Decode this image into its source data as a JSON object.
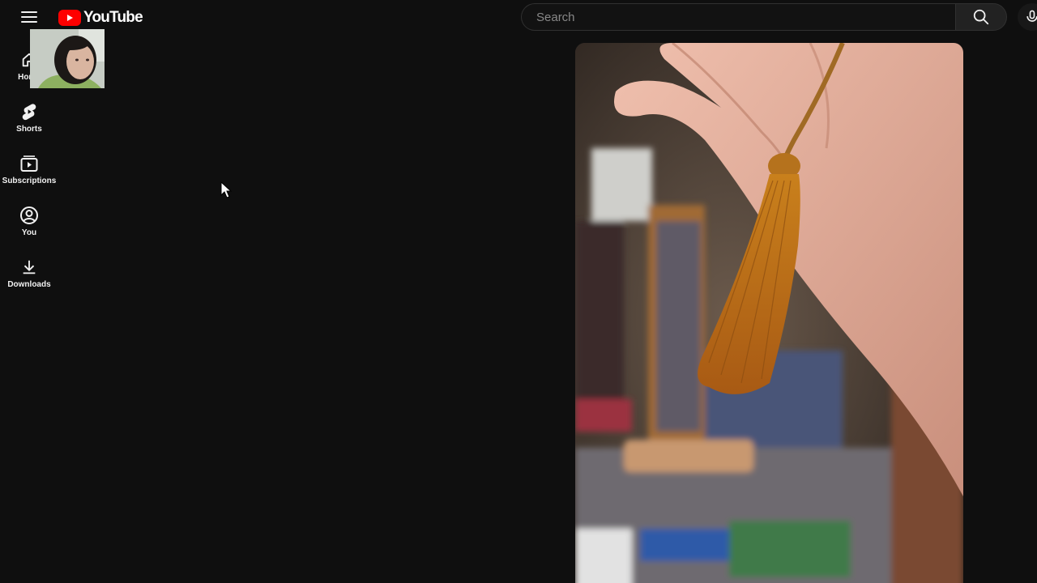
{
  "header": {
    "logo_text": "YouTube",
    "search_placeholder": "Search"
  },
  "sidebar": {
    "items": [
      {
        "label": "Home",
        "icon": "home-icon"
      },
      {
        "label": "Shorts",
        "icon": "shorts-icon"
      },
      {
        "label": "Subscriptions",
        "icon": "subscriptions-icon"
      },
      {
        "label": "You",
        "icon": "account-icon"
      },
      {
        "label": "Downloads",
        "icon": "download-icon"
      }
    ]
  },
  "colors": {
    "background": "#0f0f0f",
    "brand_red": "#ff0000",
    "text": "#f1f1f1"
  }
}
